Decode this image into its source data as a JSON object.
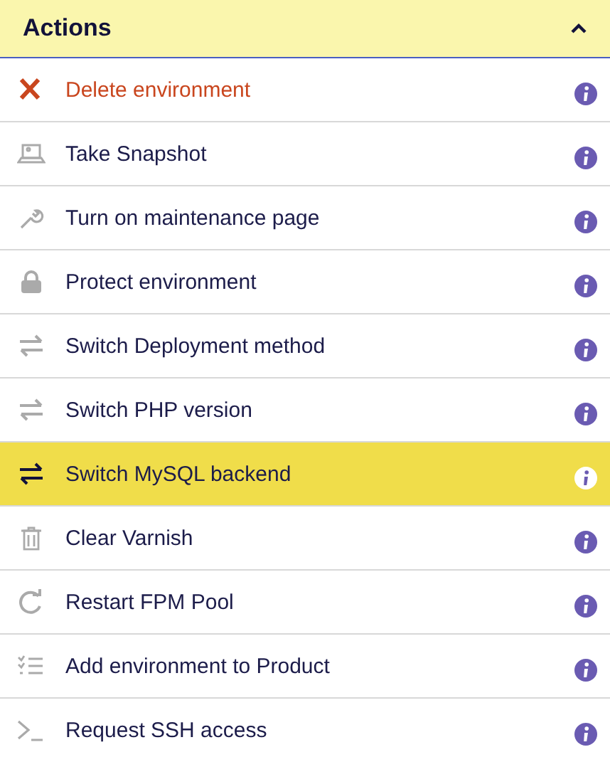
{
  "panel": {
    "title": "Actions",
    "expanded": true
  },
  "actions": [
    {
      "label": "Delete environment",
      "kind": "delete",
      "selected": false
    },
    {
      "label": "Take Snapshot",
      "kind": "snapshot",
      "selected": false
    },
    {
      "label": "Turn on maintenance page",
      "kind": "wrench",
      "selected": false
    },
    {
      "label": "Protect environment",
      "kind": "lock",
      "selected": false
    },
    {
      "label": "Switch Deployment method",
      "kind": "switch",
      "selected": false
    },
    {
      "label": "Switch PHP version",
      "kind": "switch",
      "selected": false
    },
    {
      "label": "Switch MySQL backend",
      "kind": "switch",
      "selected": true
    },
    {
      "label": "Clear Varnish",
      "kind": "trash",
      "selected": false
    },
    {
      "label": "Restart FPM Pool",
      "kind": "restart",
      "selected": false
    },
    {
      "label": "Add environment to Product",
      "kind": "checklist",
      "selected": false
    },
    {
      "label": "Request SSH access",
      "kind": "terminal",
      "selected": false
    }
  ]
}
